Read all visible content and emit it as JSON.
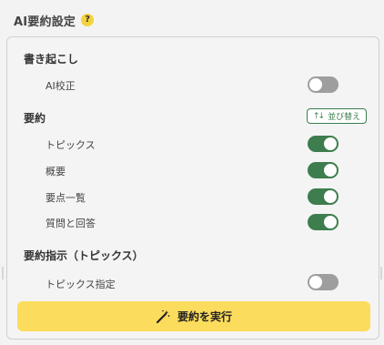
{
  "header": {
    "title": "AI要約設定",
    "help_label": "?"
  },
  "transcription": {
    "title": "書き起こし",
    "items": [
      {
        "label": "AI校正",
        "enabled": false
      }
    ]
  },
  "summary": {
    "title": "要約",
    "sort_label": "並び替え",
    "sort_icon": "↑↓",
    "items": [
      {
        "label": "トピックス",
        "enabled": true
      },
      {
        "label": "概要",
        "enabled": true
      },
      {
        "label": "要点一覧",
        "enabled": true
      },
      {
        "label": "質問と回答",
        "enabled": true
      }
    ]
  },
  "instruction": {
    "title": "要約指示（トピックス）",
    "items": [
      {
        "label": "トピックス指定",
        "enabled": false
      }
    ]
  },
  "run_button": {
    "label": "要約を実行",
    "icon": "magic-wand-icon"
  },
  "colors": {
    "toggle_on": "#3d7d4e",
    "toggle_off": "#9e9e9e",
    "run_button": "#fcdc5c",
    "help_badge": "#f4d23c"
  }
}
